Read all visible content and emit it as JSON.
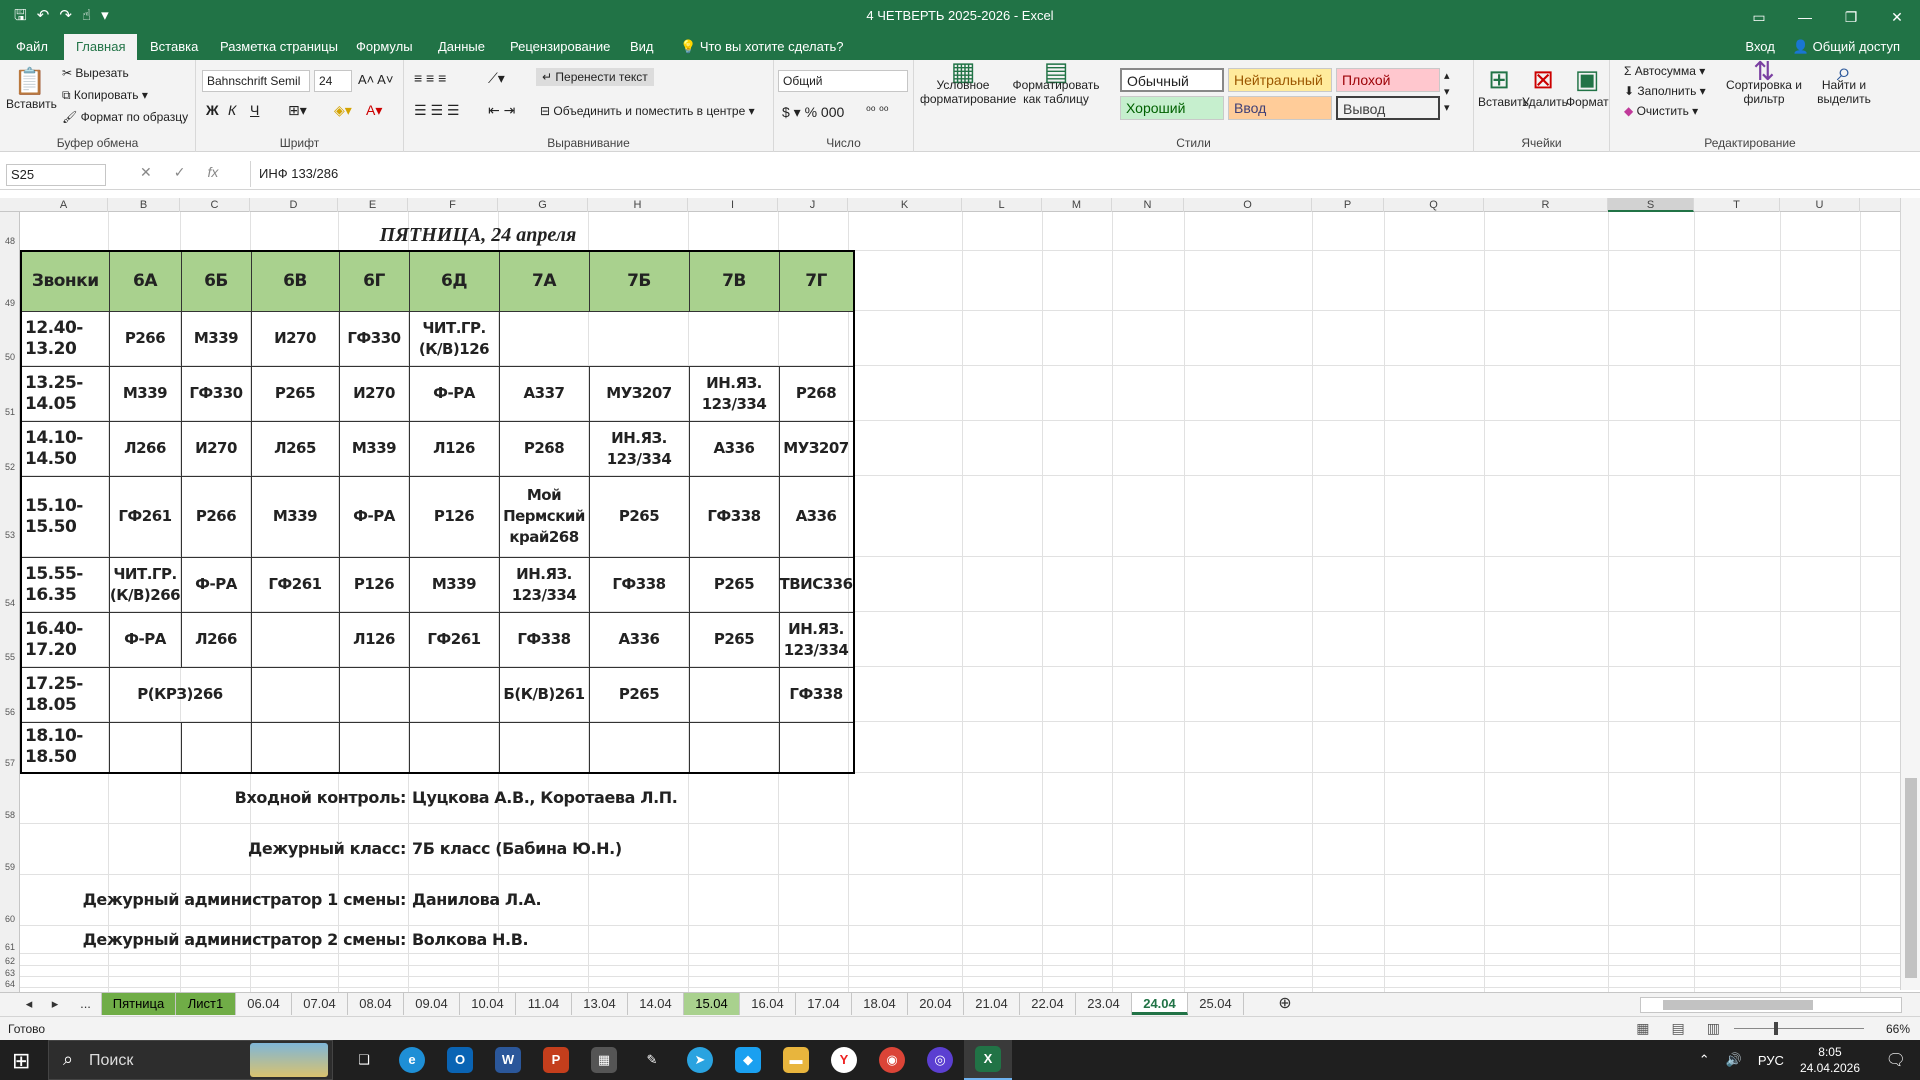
{
  "window": {
    "title": "4 ЧЕТВЕРТЬ 2025-2026  -  Excel"
  },
  "ribbon_tabs": [
    "Файл",
    "Главная",
    "Вставка",
    "Разметка страницы",
    "Формулы",
    "Данные",
    "Рецензирование",
    "Вид",
    "Что вы хотите сделать?"
  ],
  "account": {
    "signin": "Вход",
    "share": "Общий доступ"
  },
  "ribbon": {
    "clipboard": {
      "paste": "Вставить",
      "cut": "Вырезать",
      "copy": "Копировать",
      "format_painter": "Формат по образцу",
      "label": "Буфер обмена"
    },
    "font": {
      "name": "Bahnschrift Semil",
      "size": "24",
      "bold": "Ж",
      "italic": "К",
      "underline": "Ч",
      "label": "Шрифт"
    },
    "alignment": {
      "wrap": "Перенести текст",
      "merge": "Объединить и поместить в центре",
      "label": "Выравнивание"
    },
    "number": {
      "format": "Общий",
      "label": "Число"
    },
    "styles": {
      "conditional": "Условное форматирование",
      "as_table": "Форматировать как таблицу",
      "cells": [
        "Обычный",
        "Нейтральный",
        "Плохой",
        "Хороший",
        "Ввод",
        "Вывод"
      ],
      "label": "Стили"
    },
    "cells": {
      "insert": "Вставить",
      "delete": "Удалить",
      "format": "Формат",
      "label": "Ячейки"
    },
    "editing": {
      "autosum": "Автосумма",
      "fill": "Заполнить",
      "clear": "Очистить",
      "sort": "Сортировка и фильтр",
      "find": "Найти и выделить",
      "label": "Редактирование"
    }
  },
  "formula_bar": {
    "name_box": "S25",
    "formula": "ИНФ 133/286"
  },
  "columns": [
    "A",
    "B",
    "C",
    "D",
    "E",
    "F",
    "G",
    "H",
    "I",
    "J",
    "K",
    "L",
    "M",
    "N",
    "O",
    "P",
    "Q",
    "R",
    "S",
    "T",
    "U"
  ],
  "rows": [
    "48",
    "49",
    "50",
    "51",
    "52",
    "53",
    "54",
    "55",
    "56",
    "57",
    "58",
    "59",
    "60",
    "61",
    "62",
    "63",
    "64"
  ],
  "schedule": {
    "title": "ПЯТНИЦА, 24 апреля",
    "headers": [
      "Звонки",
      "6А",
      "6Б",
      "6В",
      "6Г",
      "6Д",
      "7А",
      "7Б",
      "7В",
      "7Г"
    ],
    "times": [
      "12.40-13.20",
      "13.25-14.05",
      "14.10-14.50",
      "15.10-15.50",
      "15.55-16.35",
      "16.40-17.20",
      "17.25-18.05",
      "18.10-18.50"
    ],
    "r1": [
      "Р266",
      "М339",
      "И270",
      "ГФ330",
      "ЧИТ.ГР. (К/В)126"
    ],
    "r2": [
      "М339",
      "ГФ330",
      "Р265",
      "И270",
      "Ф-РА",
      "А337",
      "МУЗ207",
      "ИН.ЯЗ. 123/334",
      "Р268"
    ],
    "r3": [
      "Л266",
      "И270",
      "Л265",
      "М339",
      "Л126",
      "Р268",
      "ИН.ЯЗ. 123/334",
      "А336",
      "МУЗ207"
    ],
    "r4": [
      "ГФ261",
      "Р266",
      "М339",
      "Ф-РА",
      "Р126",
      "Мой Пермский край268",
      "Р265",
      "ГФ338",
      "А336"
    ],
    "r5": [
      "ЧИТ.ГР. (К/В)266",
      "Ф-РА",
      "ГФ261",
      "Р126",
      "М339",
      "ИН.ЯЗ. 123/334",
      "ГФ338",
      "Р265",
      "ТВИС336"
    ],
    "r6": [
      "Ф-РА",
      "Л266",
      "",
      "Л126",
      "ГФ261",
      "ГФ338",
      "А336",
      "Р265",
      "ИН.ЯЗ. 123/334"
    ],
    "r7": [
      "Р(КРЗ)266",
      "",
      "",
      "",
      "Б(К/В)261",
      "Р265",
      "",
      "ГФ338"
    ]
  },
  "footer": {
    "entry_label": "Входной контроль:",
    "entry_value": "Цуцкова А.В., Коротаева Л.П.",
    "duty_label": "Дежурный класс:",
    "duty_value": "7Б класс (Бабина Ю.Н.)",
    "admin1_label": "Дежурный администратор 1 смены:",
    "admin1_value": "Данилова Л.А.",
    "admin2_label": "Дежурный администратор 2 смены:",
    "admin2_value": "Волкова Н.В."
  },
  "sheets": [
    "...",
    "Пятница",
    "Лист1",
    "06.04",
    "07.04",
    "08.04",
    "09.04",
    "10.04",
    "11.04",
    "13.04",
    "14.04",
    "15.04",
    "16.04",
    "17.04",
    "18.04",
    "20.04",
    "21.04",
    "22.04",
    "23.04",
    "24.04",
    "25.04"
  ],
  "status": {
    "ready": "Готово",
    "zoom": "66%"
  },
  "taskbar": {
    "search": "Поиск",
    "lang": "РУС",
    "time": "8:05",
    "date": "24.04.2026"
  }
}
